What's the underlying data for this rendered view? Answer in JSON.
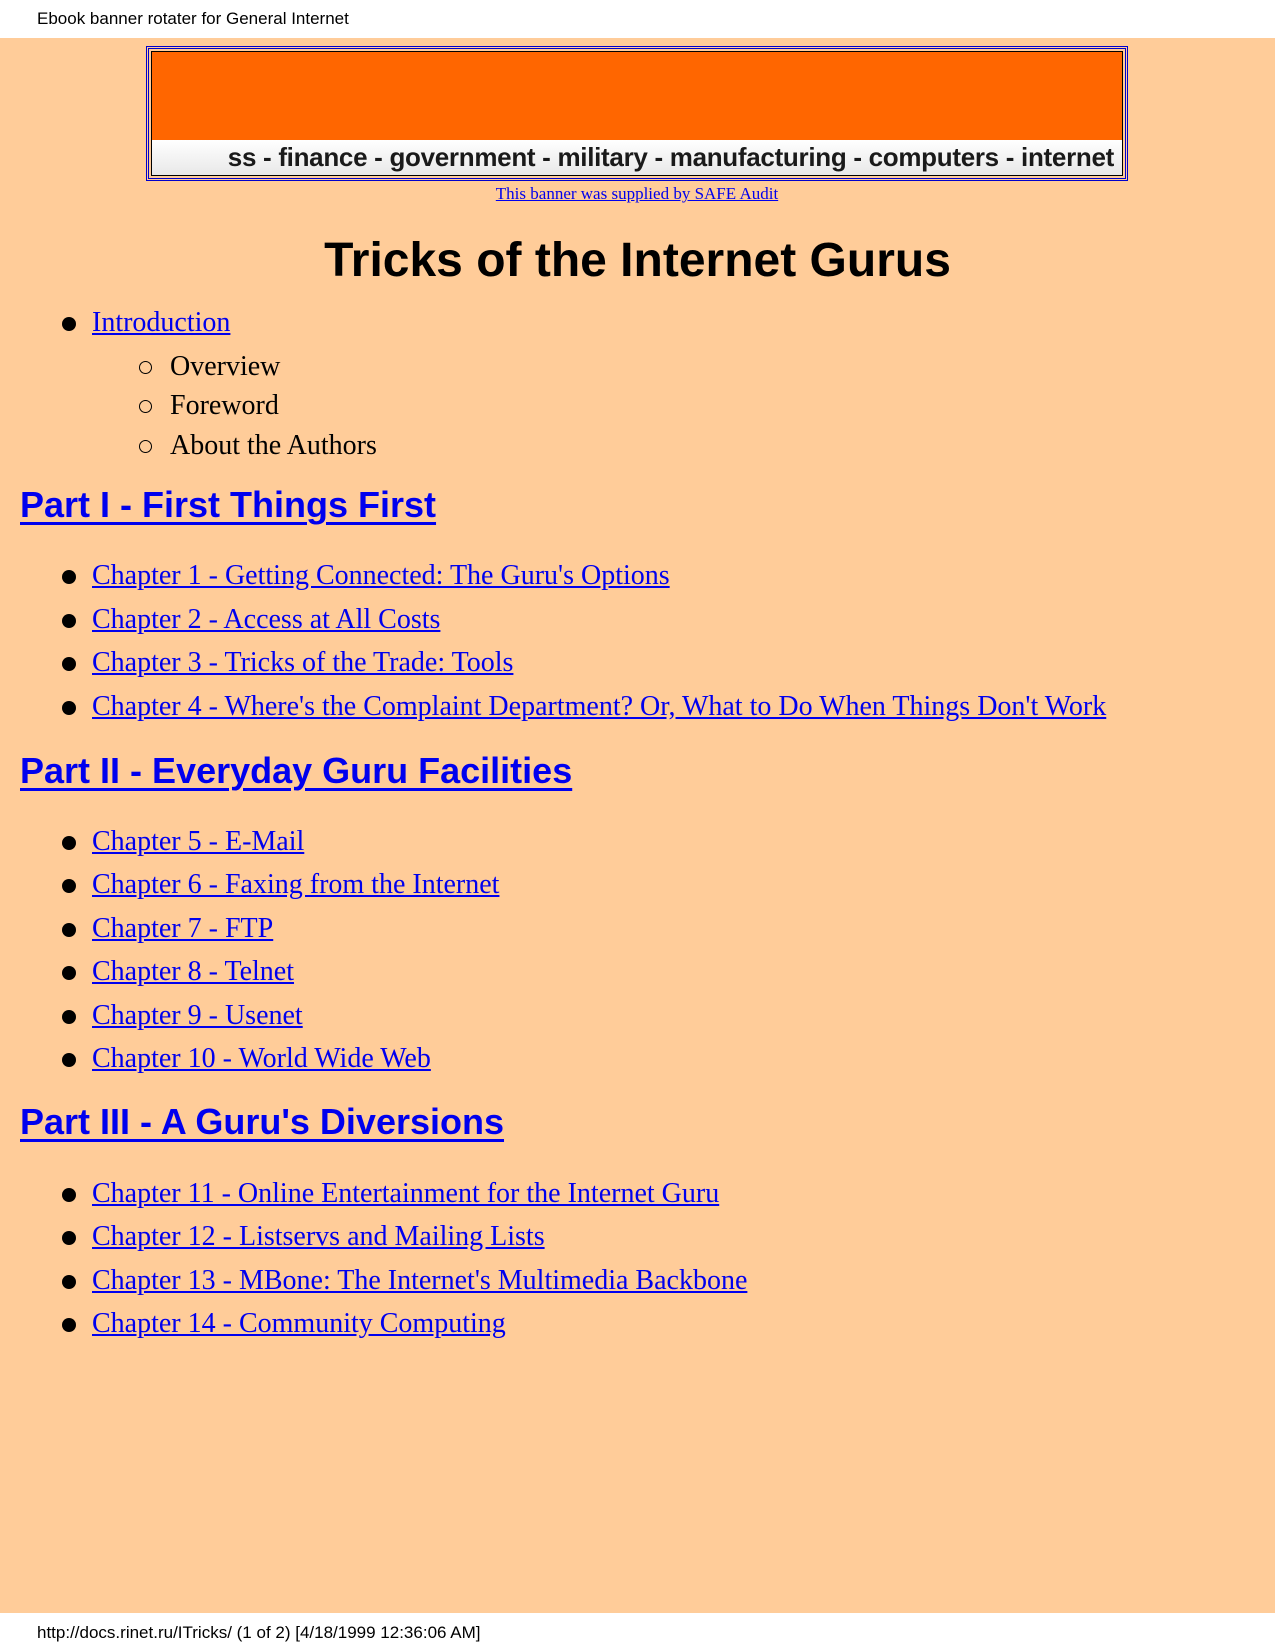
{
  "print_header": "Ebook banner rotater for General Internet",
  "banner": {
    "ticker_text": "ss - finance -  government - military - manufacturing - computers - internet",
    "credit_link": "This banner was supplied by SAFE Audit",
    "colors": {
      "banner": "#ff6600",
      "background": "#ffcc99",
      "link": "#0000ee"
    }
  },
  "title": "Tricks of the Internet Gurus",
  "introduction": {
    "label": "Introduction",
    "subitems": [
      "Overview",
      "Foreword",
      "About the Authors"
    ]
  },
  "parts": [
    {
      "heading": "Part I - First Things First",
      "chapters": [
        "Chapter 1 - Getting Connected: The Guru's Options",
        "Chapter 2 - Access at All Costs",
        "Chapter 3 - Tricks of the Trade: Tools",
        "Chapter 4 - Where's the Complaint Department? Or, What to Do When Things Don't Work"
      ]
    },
    {
      "heading": "Part II - Everyday Guru Facilities",
      "chapters": [
        "Chapter 5 - E-Mail",
        "Chapter 6 - Faxing from the Internet",
        "Chapter 7 - FTP",
        "Chapter 8 - Telnet",
        "Chapter 9 - Usenet",
        "Chapter 10 - World Wide Web"
      ]
    },
    {
      "heading": "Part III - A Guru's Diversions",
      "chapters": [
        "Chapter 11 - Online Entertainment for the Internet Guru",
        "Chapter 12 - Listservs and Mailing Lists",
        "Chapter 13 - MBone: The Internet's Multimedia Backbone",
        "Chapter 14 - Community Computing"
      ]
    }
  ],
  "print_footer": "http://docs.rinet.ru/ITricks/ (1 of 2) [4/18/1999 12:36:06 AM]"
}
